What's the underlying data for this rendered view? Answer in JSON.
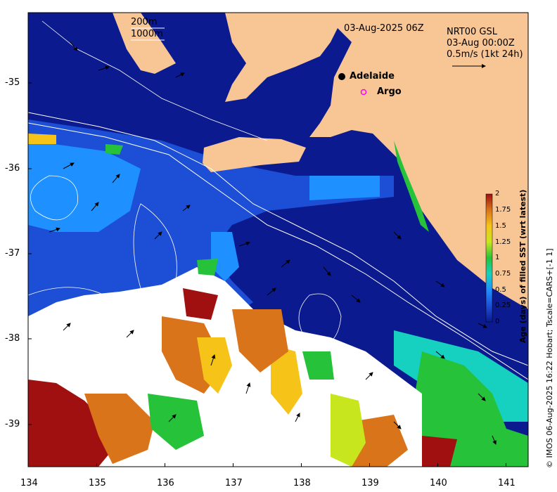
{
  "map": {
    "timestamp_label": "03-Aug-2025 06Z",
    "product": {
      "name": "NRT00 GSL",
      "time": "03-Aug 00:00Z",
      "vector_scale": "0.5m/s (1kt 24h)"
    },
    "isobath_labels": [
      "200m",
      "1000m"
    ],
    "places": [
      {
        "name": "Adelaide",
        "marker": "filled-dot"
      },
      {
        "name": "Argo",
        "marker": "magenta-ring"
      }
    ],
    "x_ticks": [
      "134",
      "135",
      "136",
      "137",
      "138",
      "139",
      "140",
      "141"
    ],
    "y_ticks": [
      "-35",
      "-36",
      "-37",
      "-38",
      "-39"
    ],
    "colorbar": {
      "title": "Age (days) of filled SST (wrt latest)",
      "ticks": [
        "2",
        "1.75",
        "1.5",
        "1.25",
        "1",
        "0.75",
        "0.5",
        "0.25",
        "0"
      ],
      "range": [
        0,
        2
      ]
    },
    "credit": "© IMOS 06-Aug-2025 16:22 Hobart; Tscale=CARS+[-1 1]",
    "colors": {
      "land": "#f8c594",
      "age_0": "#0b1a8f",
      "age_0_25": "#1d4fd6",
      "age_0_5": "#1e90ff",
      "age_0_75": "#16d0c0",
      "age_1": "#25c23a",
      "age_1_25": "#c8e61e",
      "age_1_5": "#f6c419",
      "age_1_75": "#d9741a",
      "age_2": "#a01010",
      "no_data": "#ffffff",
      "adelaide_marker": "#000000",
      "argo_marker": "#ff00ff",
      "vectors": "#000000",
      "isobaths": "#ffffff"
    }
  }
}
